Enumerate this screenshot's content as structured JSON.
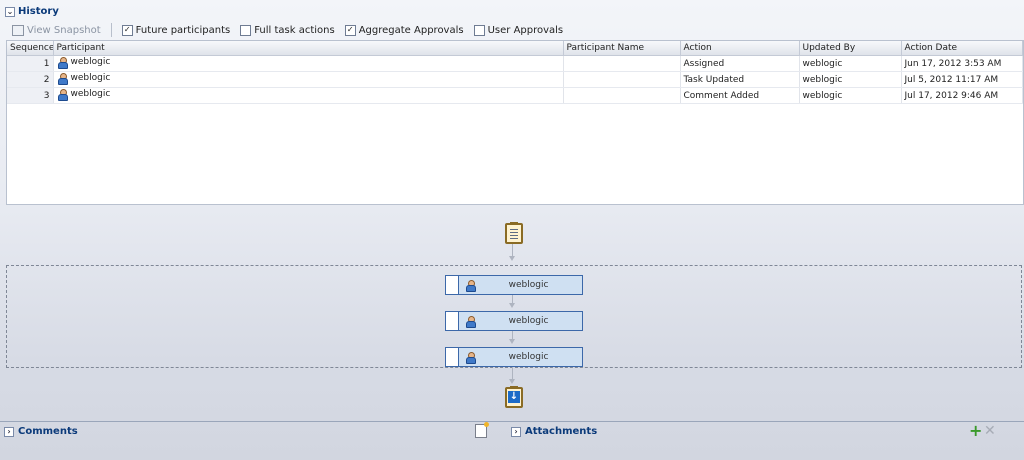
{
  "history": {
    "title": "History",
    "toolbar": {
      "view_snapshot": "View Snapshot",
      "future_participants": "Future participants",
      "full_task_actions": "Full task actions",
      "aggregate_approvals": "Aggregate Approvals",
      "user_approvals": "User Approvals",
      "checked": {
        "future_participants": true,
        "full_task_actions": false,
        "aggregate_approvals": true,
        "user_approvals": false
      }
    },
    "columns": [
      "Sequence",
      "Participant",
      "Participant Name",
      "Action",
      "Updated By",
      "Action Date"
    ],
    "rows": [
      {
        "seq": "1",
        "participant": "weblogic",
        "participant_name": "",
        "action": "Assigned",
        "updated_by": "weblogic",
        "date": "Jun 17, 2012 3:53 AM"
      },
      {
        "seq": "2",
        "participant": "weblogic",
        "participant_name": "",
        "action": "Task Updated",
        "updated_by": "weblogic",
        "date": "Jul 5, 2012 11:17 AM"
      },
      {
        "seq": "3",
        "participant": "weblogic",
        "participant_name": "",
        "action": "Comment Added",
        "updated_by": "weblogic",
        "date": "Jul 17, 2012 9:46 AM"
      }
    ]
  },
  "flow": {
    "nodes": [
      "weblogic",
      "weblogic",
      "weblogic"
    ]
  },
  "comments": {
    "title": "Comments"
  },
  "attachments": {
    "title": "Attachments"
  },
  "icons": {
    "participant": "person-icon",
    "flow_start": "task-clipboard-icon",
    "flow_end": "task-complete-icon",
    "add_comment": "add-note-icon",
    "add_attachment": "add-icon",
    "remove_attachment": "remove-icon"
  }
}
